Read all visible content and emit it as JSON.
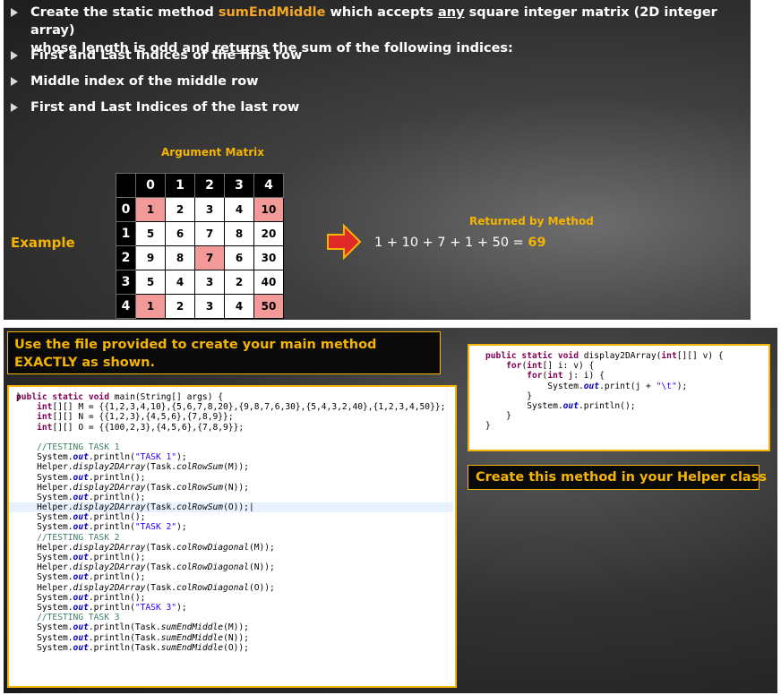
{
  "top": {
    "bullets": [
      {
        "pre": "Create the static method ",
        "method": "sumEndMiddle",
        "mid": " which accepts ",
        "any": "any",
        "mid2": " square integer matrix (2D integer array)",
        "line2a": "whose length is odd and ",
        "returns": "returns",
        "line2b": " the sum of the following indices:"
      },
      {
        "text": "First and Last Indices of the first row"
      },
      {
        "text": "Middle index of the middle row"
      },
      {
        "text": "First and Last Indices of the last row"
      }
    ],
    "matrix_title": "Argument Matrix",
    "col_headers": [
      "0",
      "1",
      "2",
      "3",
      "4"
    ],
    "rows": [
      {
        "idx": "0",
        "cells": [
          "1",
          "2",
          "3",
          "4",
          "10"
        ]
      },
      {
        "idx": "1",
        "cells": [
          "5",
          "6",
          "7",
          "8",
          "20"
        ]
      },
      {
        "idx": "2",
        "cells": [
          "9",
          "8",
          "7",
          "6",
          "30"
        ]
      },
      {
        "idx": "3",
        "cells": [
          "5",
          "4",
          "3",
          "2",
          "40"
        ]
      },
      {
        "idx": "4",
        "cells": [
          "1",
          "2",
          "3",
          "4",
          "50"
        ]
      }
    ],
    "example_label": "Example",
    "returned_label": "Returned by Method",
    "returned_expr": "1 + 10 + 7 + 1 + 50 = ",
    "returned_value": "69",
    "colors": {
      "accent": "#f5b400",
      "highlight_cell": "#f29a98",
      "arrow": "#e02a2a"
    }
  },
  "bottom": {
    "instruction": "Use the file provided to create your main method EXACTLY as shown.",
    "helper_note": "Create this method in your Helper class"
  }
}
